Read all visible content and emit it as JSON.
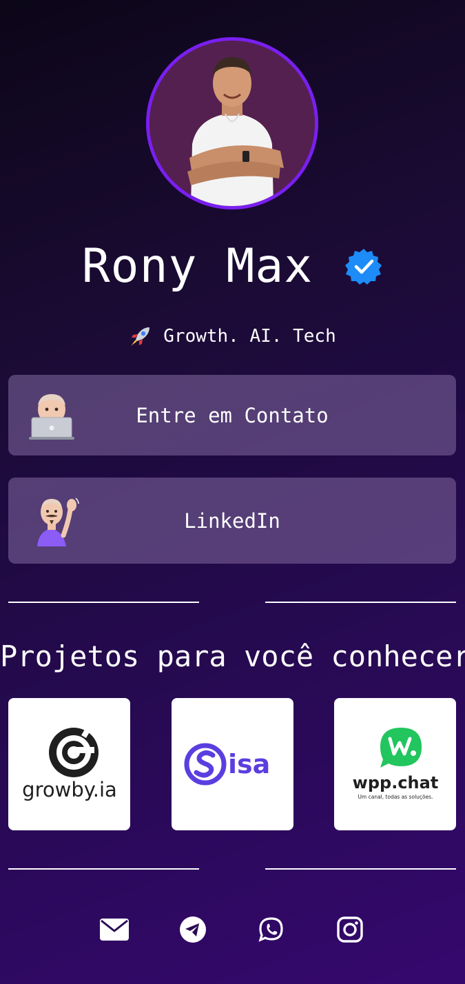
{
  "profile": {
    "name": "Rony Max",
    "verified_icon": "verified-badge-icon",
    "tagline_icon": "rocket-icon",
    "tagline": "Growth. AI. Tech",
    "avatar_ring_color": "#7a1ff0"
  },
  "links": [
    {
      "label": "Entre em Contato",
      "icon": "memoji-laptop-icon"
    },
    {
      "label": "LinkedIn",
      "icon": "memoji-waving-icon"
    }
  ],
  "projects": {
    "title": "Projetos para você conhecer",
    "items": [
      {
        "name": "growby.ia",
        "logo": "growby-logo"
      },
      {
        "name": "isa",
        "logo": "isa-logo"
      },
      {
        "name": "wpp.chat",
        "tagline": "Um canal, todas as soluções.",
        "logo": "wppchat-logo"
      }
    ]
  },
  "social": [
    {
      "icon": "email-icon"
    },
    {
      "icon": "telegram-icon"
    },
    {
      "icon": "whatsapp-icon"
    },
    {
      "icon": "instagram-icon"
    }
  ],
  "colors": {
    "accent": "#7a1ff0",
    "verified": "#1d8cf8",
    "isa": "#5b3ee0",
    "wpp": "#22c55e",
    "button_bg": "rgba(120,95,150,0.62)"
  }
}
